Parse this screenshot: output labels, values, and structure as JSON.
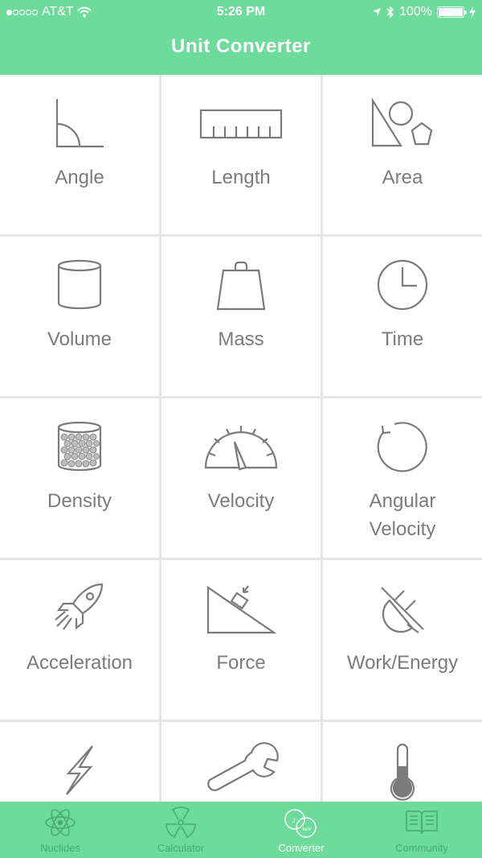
{
  "status": {
    "carrier": "AT&T",
    "time": "5:26 PM",
    "battery": "100%"
  },
  "header": {
    "title": "Unit Converter"
  },
  "tiles": [
    {
      "label": "Angle",
      "icon": "angle-icon"
    },
    {
      "label": "Length",
      "icon": "ruler-icon"
    },
    {
      "label": "Area",
      "icon": "shapes-icon"
    },
    {
      "label": "Volume",
      "icon": "cylinder-icon"
    },
    {
      "label": "Mass",
      "icon": "weight-icon"
    },
    {
      "label": "Time",
      "icon": "clock-icon"
    },
    {
      "label": "Density",
      "icon": "jar-of-balls-icon"
    },
    {
      "label": "Velocity",
      "icon": "speedometer-icon"
    },
    {
      "label": "Angular\nVelocity",
      "icon": "rotation-icon"
    },
    {
      "label": "Acceleration",
      "icon": "rocket-icon"
    },
    {
      "label": "Force",
      "icon": "incline-block-icon"
    },
    {
      "label": "Work/Energy",
      "icon": "plug-icon"
    },
    {
      "label": "",
      "icon": "lightning-icon"
    },
    {
      "label": "",
      "icon": "wrench-icon"
    },
    {
      "label": "",
      "icon": "thermometer-icon"
    }
  ],
  "tabs": [
    {
      "label": "Nuclides",
      "icon": "atom-icon"
    },
    {
      "label": "Calculator",
      "icon": "radiation-icon"
    },
    {
      "label": "Converter",
      "icon": "converter-icon"
    },
    {
      "label": "Community",
      "icon": "book-icon"
    }
  ],
  "colors": {
    "accent": "#6ddc9b",
    "icon_stroke": "#7b7b7b"
  }
}
